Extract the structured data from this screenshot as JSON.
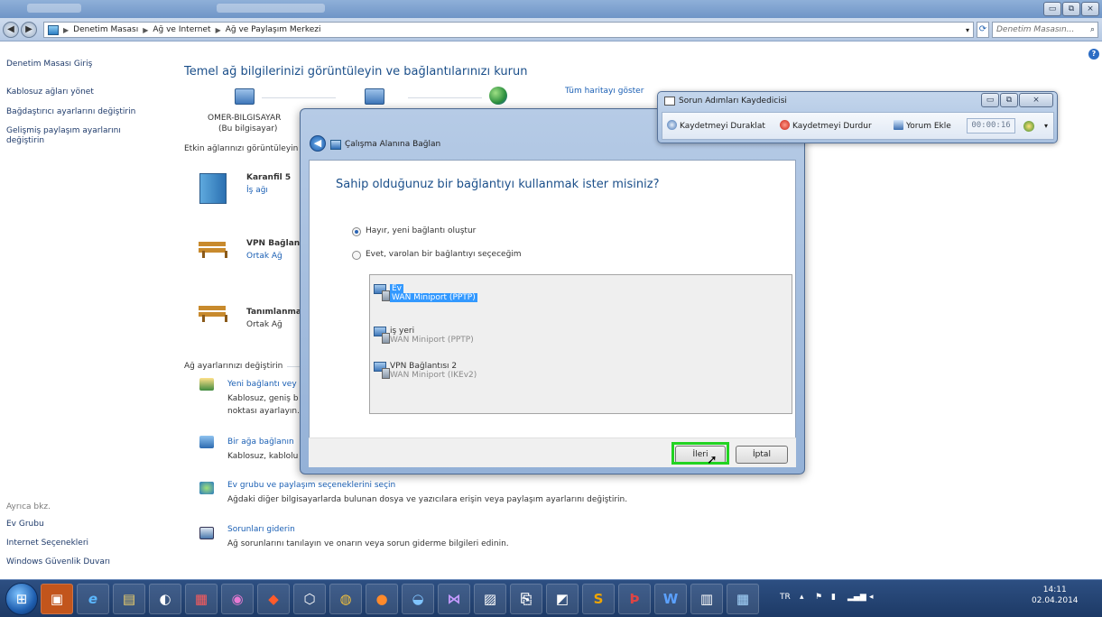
{
  "window": {
    "buttons": {
      "minimize": "▭",
      "maximize": "⧉",
      "close": "⨯"
    }
  },
  "address": {
    "breadcrumbs": [
      "Denetim Masası",
      "Ağ ve Internet",
      "Ağ ve Paylaşım Merkezi"
    ],
    "search_placeholder": "Denetim Masasın..."
  },
  "sidebar": {
    "links": [
      "Denetim Masası Giriş",
      "Kablosuz ağları yönet",
      "Bağdaştırıcı ayarlarını değiştirin",
      "Gelişmiş paylaşım ayarlarını",
      "değiştirin"
    ],
    "see_also_title": "Ayrıca bkz.",
    "see_also": [
      "Ev Grubu",
      "Internet Seçenekleri",
      "Windows Güvenlik Duvarı"
    ]
  },
  "main": {
    "heading": "Temel ağ bilgilerinizi görüntüleyin ve bağlantılarınızı kurun",
    "full_map_link": "Tüm haritayı göster",
    "computer_name": "OMER-BILGISAYAR",
    "computer_sub": "(Bu bilgisayar)",
    "active_networks_label": "Etkin ağlarınızı görüntüleyin",
    "networks": [
      {
        "name": "Karanfil 5",
        "type": "İş ağı"
      },
      {
        "name": "VPN Bağlant",
        "type": "Ortak Ağ"
      },
      {
        "name": "Tanımlanma",
        "type": "Ortak Ağ"
      }
    ],
    "change_settings_label": "Ağ ayarlarınızı değiştirin",
    "tasks": [
      {
        "title": "Yeni bağlantı vey",
        "desc1": "Kablosuz, geniş b",
        "desc2": "noktası ayarlayın."
      },
      {
        "title": "Bir ağa bağlanın",
        "desc1": "Kablosuz, kablolu",
        "desc2": ""
      },
      {
        "title": "Ev grubu ve paylaşım seçeneklerini seçin",
        "desc1": "Ağdaki diğer bilgisayarlarda bulunan dosya ve yazıcılara erişin veya paylaşım ayarlarını değiştirin.",
        "desc2": ""
      },
      {
        "title": "Sorunları giderin",
        "desc1": "Ağ sorunlarını tanılayın ve onarın veya sorun giderme bilgileri edinin.",
        "desc2": ""
      }
    ]
  },
  "dialog": {
    "title": "Çalışma Alanına Bağlan",
    "question": "Sahip olduğunuz bir bağlantıyı kullanmak ister misiniz?",
    "option_new": "Hayır, yeni bağlantı oluştur",
    "option_existing": "Evet, varolan bir bağlantıyı seçeceğim",
    "selected_option": "option_new",
    "connections": [
      {
        "name": "Ev",
        "type": "WAN Miniport (PPTP)",
        "selected": true
      },
      {
        "name": "iş yeri",
        "type": "WAN Miniport (PPTP)",
        "selected": false
      },
      {
        "name": "VPN Bağlantısı 2",
        "type": "WAN Miniport (IKEv2)",
        "selected": false
      }
    ],
    "next_label": "İleri",
    "cancel_label": "İptal"
  },
  "psr": {
    "title": "Sorun Adımları Kaydedicisi",
    "pause_label": "Kaydetmeyi Duraklat",
    "stop_label": "Kaydetmeyi Durdur",
    "comment_label": "Yorum Ekle",
    "timer": "00:00:16"
  },
  "taskbar": {
    "language": "TR",
    "time": "14:11",
    "date": "02.04.2014"
  }
}
